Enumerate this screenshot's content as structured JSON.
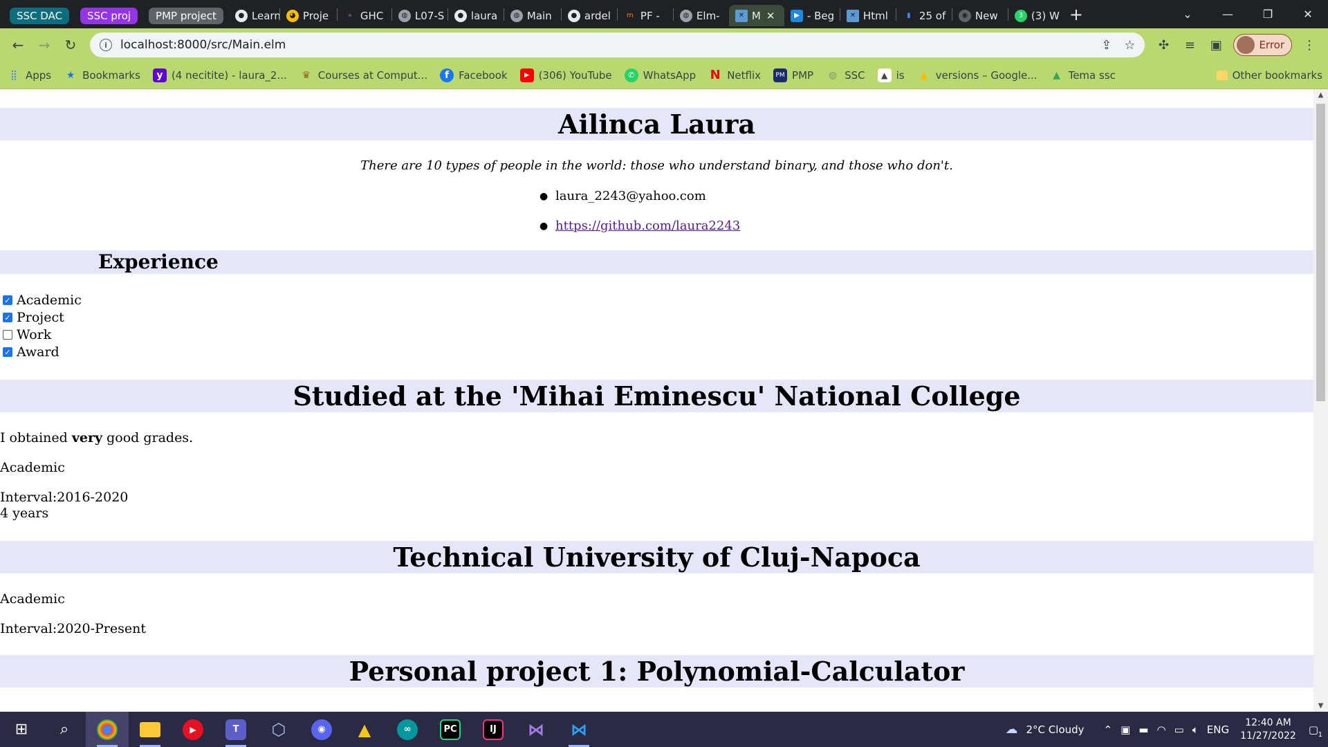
{
  "browser": {
    "tabs": [
      {
        "label": "SSC DAC",
        "kind": "group",
        "color": "#0b6e7e"
      },
      {
        "label": "SSC proj",
        "kind": "group",
        "color": "#9334e6"
      },
      {
        "label": "PMP project",
        "kind": "group",
        "color": "#5f6368"
      },
      {
        "label": "Learn",
        "icon": "github-icon"
      },
      {
        "label": "Proje",
        "icon": "pacman-icon"
      },
      {
        "label": "GHC",
        "icon": "haskell-icon"
      },
      {
        "label": "L07-S",
        "icon": "globe-icon"
      },
      {
        "label": "laura",
        "icon": "github-icon"
      },
      {
        "label": "Main",
        "icon": "globe-icon"
      },
      {
        "label": "ardel",
        "icon": "github-icon"
      },
      {
        "label": "PF -",
        "icon": "moodle-icon"
      },
      {
        "label": "Elm-",
        "icon": "globe-icon"
      },
      {
        "label": "M",
        "icon": "elm-icon",
        "active": true
      },
      {
        "label": "- Beg",
        "icon": "video-icon"
      },
      {
        "label": "Html",
        "icon": "elm-icon"
      },
      {
        "label": "25 of",
        "icon": "doc-icon"
      },
      {
        "label": "New",
        "icon": "chrome-icon"
      },
      {
        "label": "(3) W",
        "icon": "whatsapp-icon"
      }
    ],
    "url": "localhost:8000/src/Main.elm",
    "profile_label": "Error",
    "bookmarks": [
      {
        "label": "Apps",
        "icon": "apps-grid-icon"
      },
      {
        "label": "Bookmarks",
        "icon": "star-icon"
      },
      {
        "label": "(4 necitite) - laura_2...",
        "icon": "yahoo-icon"
      },
      {
        "label": "Courses at Comput...",
        "icon": "courses-icon"
      },
      {
        "label": "Facebook",
        "icon": "facebook-icon"
      },
      {
        "label": "(306) YouTube",
        "icon": "youtube-icon"
      },
      {
        "label": "WhatsApp",
        "icon": "whatsapp-icon"
      },
      {
        "label": "Netflix",
        "icon": "netflix-icon"
      },
      {
        "label": "PMP",
        "icon": "pmp-icon"
      },
      {
        "label": "SSC",
        "icon": "globe-icon"
      },
      {
        "label": "is",
        "icon": "is-icon"
      },
      {
        "label": "versions – Google...",
        "icon": "google-drive-icon"
      },
      {
        "label": "Tema ssc",
        "icon": "google-drive-icon"
      }
    ],
    "other_bookmarks": "Other bookmarks"
  },
  "page": {
    "name": "Ailinca Laura",
    "quote": "There are 10 types of people in the world: those who understand binary, and those who don't.",
    "email": "laura_2243@yahoo.com",
    "github": "https://github.com/laura2243",
    "experience_heading": "Experience",
    "filters": [
      {
        "label": "Academic",
        "checked": true
      },
      {
        "label": "Project",
        "checked": true
      },
      {
        "label": "Work",
        "checked": false
      },
      {
        "label": "Award",
        "checked": true
      }
    ],
    "sections": [
      {
        "title": "Studied at the 'Mihai Eminescu' National College",
        "desc_before": "I obtained ",
        "desc_bold": "very",
        "desc_after": " good grades.",
        "category": "Academic",
        "interval": "Interval:2016-2020",
        "duration": "4 years"
      },
      {
        "title": "Technical University of Cluj-Napoca",
        "category": "Academic",
        "interval": "Interval:2020-Present"
      },
      {
        "title": "Personal project 1: Polynomial-Calculator"
      }
    ]
  },
  "taskbar": {
    "apps": [
      "windows-start-icon",
      "search-icon",
      "chrome-icon",
      "file-explorer-icon",
      "media-player-icon",
      "teams-icon",
      "virtualbox-icon",
      "discord-icon",
      "anaconda-icon",
      "arduino-icon",
      "pycharm-icon",
      "intellij-icon",
      "visual-studio-icon",
      "vscode-icon"
    ],
    "weather": "2°C  Cloudy",
    "language": "ENG",
    "time": "12:40 AM",
    "date": "11/27/2022",
    "notifications": "1"
  }
}
